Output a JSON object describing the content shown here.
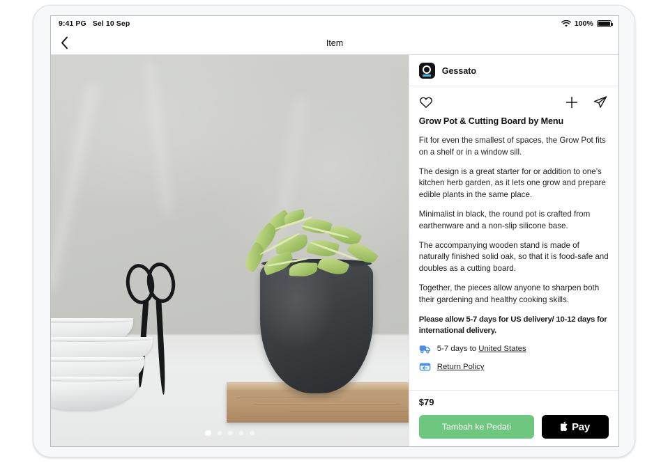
{
  "status_bar": {
    "time": "9:41 PG",
    "date": "Sel 10 Sep",
    "battery_percent": "100%",
    "wifi_icon": "wifi-icon",
    "battery_icon": "battery-full-icon"
  },
  "nav_bar": {
    "back_icon": "chevron-left-icon",
    "title": "Item"
  },
  "gallery": {
    "page_count": 5,
    "active_page": 1,
    "image_alt": "Grow pot with herbs on an oak cutting board beside stacked bowls and scissors"
  },
  "detail": {
    "brand": {
      "name": "Gessato",
      "logo_icon": "gessato-logo-icon"
    },
    "actions": {
      "like_icon": "heart-icon",
      "add_icon": "plus-icon",
      "share_icon": "paper-plane-icon"
    },
    "product_title": "Grow Pot & Cutting Board by Menu",
    "description": [
      "Fit for even the smallest of spaces, the Grow Pot fits on a shelf or in a window sill.",
      "The design is a great starter for or addition to one’s kitchen herb garden, as it lets one grow and prepare edible plants in the same place.",
      "Minimalist in black, the round pot is crafted from earthenware and a non-slip silicone base.",
      "The accompanying wooden stand is made of naturally finished solid oak, so that it is food-safe and doubles as a cutting board.",
      "Together, the pieces allow anyone to sharpen both their gardening and healthy cooking skills."
    ],
    "delivery_note": "Please allow 5-7 days for US delivery/ 10-12 days for international delivery.",
    "shipping": {
      "truck_icon": "delivery-truck-icon",
      "estimate_prefix": "5-7 days to ",
      "destination": "United States",
      "return_icon": "return-box-icon",
      "return_label": "Return Policy"
    },
    "purchase": {
      "price": "$79",
      "add_to_cart_label": "Tambah ke Pedati",
      "apple_pay_label": "Pay",
      "apple_icon": "apple-logo-icon"
    }
  },
  "colors": {
    "add_to_cart_green": "#6ec77e",
    "apple_pay_black": "#000000",
    "link_blue_icon": "#4a90e8",
    "brand_accent_cyan": "#33c5e8"
  },
  "device": {
    "camera_icon": "front-camera-icon",
    "home_button_icon": "home-button-icon"
  }
}
